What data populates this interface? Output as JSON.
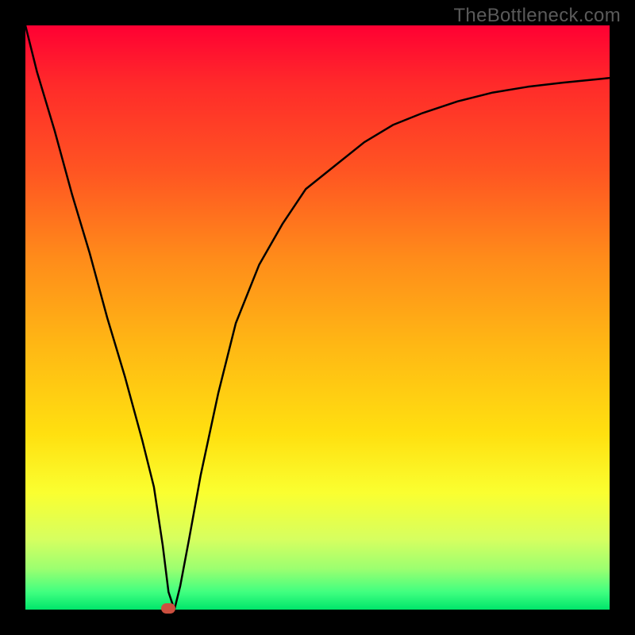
{
  "watermark": "TheBottleneck.com",
  "chart_data": {
    "type": "line",
    "title": "",
    "xlabel": "",
    "ylabel": "",
    "xlim": [
      0,
      100
    ],
    "ylim": [
      0,
      100
    ],
    "grid": false,
    "legend": false,
    "x": [
      0,
      2,
      5,
      8,
      11,
      14,
      17,
      20,
      22,
      23.5,
      24.5,
      25.5,
      26.5,
      28,
      30,
      33,
      36,
      40,
      44,
      48,
      53,
      58,
      63,
      68,
      74,
      80,
      86,
      92,
      98,
      100
    ],
    "values": [
      100,
      92,
      82,
      71,
      61,
      50,
      40,
      29,
      21,
      11,
      3,
      0,
      4,
      12,
      23,
      37,
      49,
      59,
      66,
      72,
      76,
      80,
      83,
      85,
      87,
      88.5,
      89.5,
      90.2,
      90.8,
      91
    ],
    "marker": {
      "x": 24.5,
      "y": 0,
      "color": "#cc4f3f"
    },
    "background_gradient": {
      "top_color": "#ff0033",
      "bottom_color": "#00e56b",
      "meaning": "red (top) = worse, green (bottom) = better"
    }
  },
  "colors": {
    "frame": "#000000",
    "curve": "#000000",
    "watermark": "#5a5a5a"
  }
}
